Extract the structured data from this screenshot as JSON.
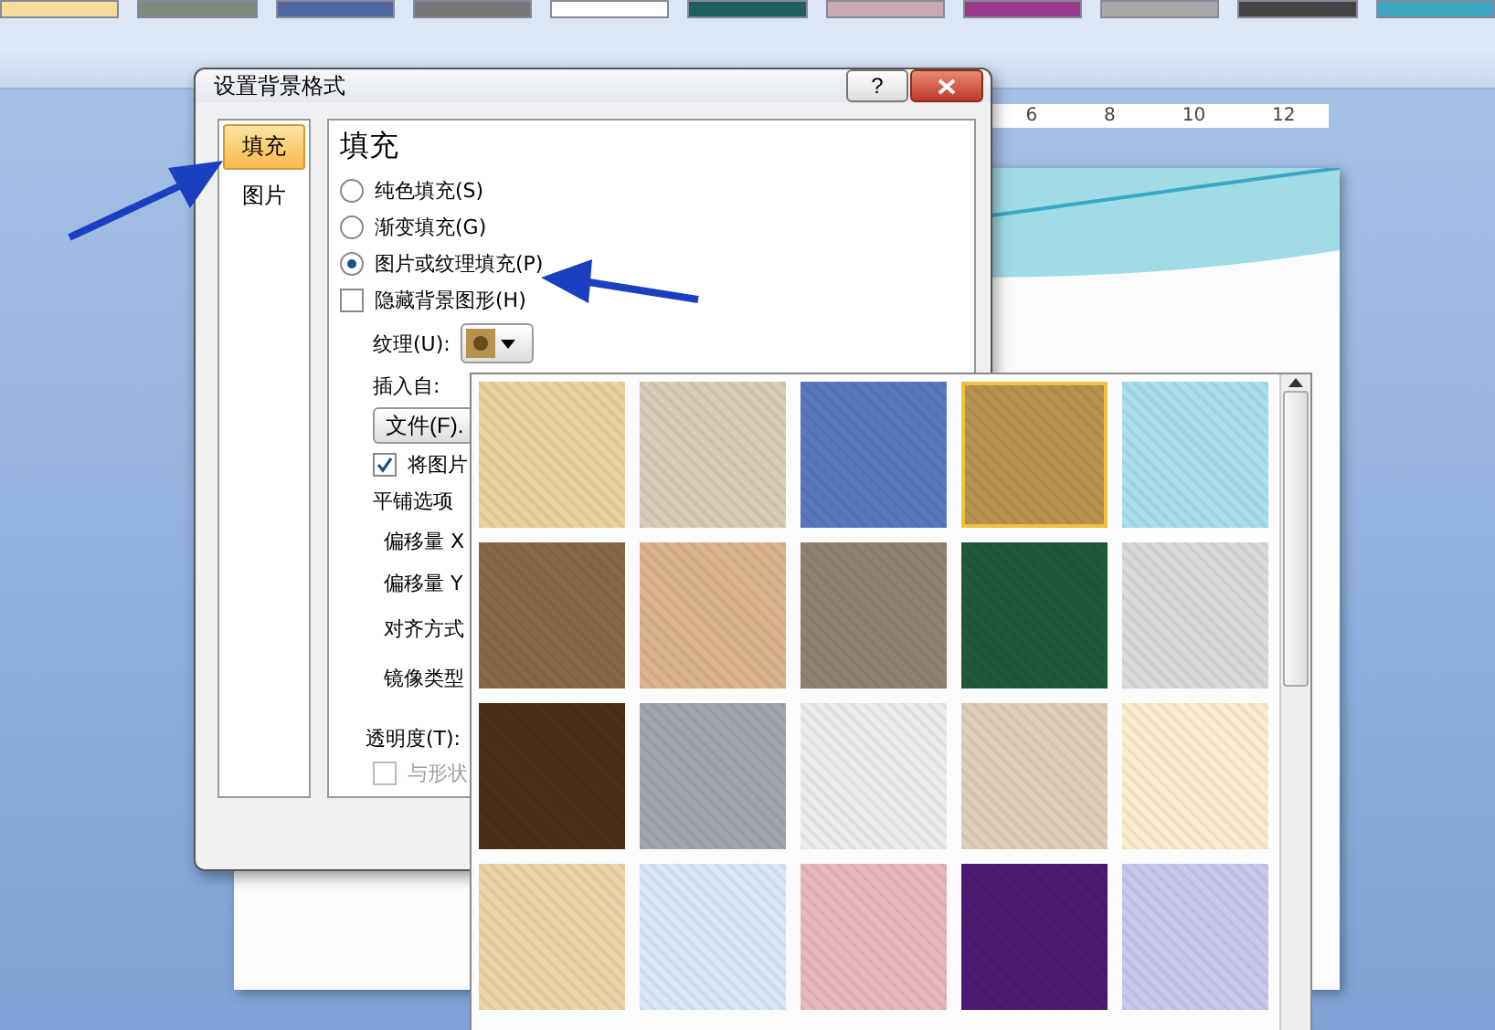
{
  "ruler": {
    "ticks": [
      "6",
      "8",
      "10",
      "12"
    ]
  },
  "dialog": {
    "title": "设置背景格式",
    "help": "?",
    "categories": [
      {
        "label": "填充",
        "selected": true
      },
      {
        "label": "图片",
        "selected": false
      }
    ],
    "heading": "填充",
    "fill_options": [
      {
        "label": "纯色填充(S)",
        "selected": false
      },
      {
        "label": "渐变填充(G)",
        "selected": false
      },
      {
        "label": "图片或纹理填充(P)",
        "selected": true
      }
    ],
    "hide_background": {
      "label": "隐藏背景图形(H)",
      "checked": false
    },
    "texture_label": "纹理(U):",
    "insert_from": "插入自:",
    "file_button": "文件(F).",
    "tile_checkbox": {
      "label": "将图片",
      "checked": true
    },
    "tiling_options": "平铺选项",
    "offset_x": "偏移量 X",
    "offset_y": "偏移量 Y",
    "alignment": "对齐方式",
    "mirror": "镜像类型",
    "transparency": "透明度(T):",
    "rotate_with_shape": {
      "label": "与形状",
      "checked": false,
      "disabled": true
    }
  },
  "texture_gallery": {
    "textures": [
      {
        "color": "#e9d39e",
        "selected": false
      },
      {
        "color": "#d8cdb6",
        "selected": false
      },
      {
        "color": "#5a78c0",
        "selected": false
      },
      {
        "color": "#b8924f",
        "selected": true
      },
      {
        "color": "#a9e0ec",
        "selected": false
      },
      {
        "color": "#8a6a45",
        "selected": false
      },
      {
        "color": "#d9b48d",
        "selected": false
      },
      {
        "color": "#8f8272",
        "selected": false
      },
      {
        "color": "#1f5a3a",
        "selected": false
      },
      {
        "color": "#dadada",
        "selected": false
      },
      {
        "color": "#4a2e16",
        "selected": false
      },
      {
        "color": "#a4a6ad",
        "selected": false
      },
      {
        "color": "#ececec",
        "selected": false
      },
      {
        "color": "#dfd0bc",
        "selected": false
      },
      {
        "color": "#fbecd0",
        "selected": false
      },
      {
        "color": "#ecd6a8",
        "selected": false
      },
      {
        "color": "#d9e8f8",
        "selected": false
      },
      {
        "color": "#e6b8bc",
        "selected": false
      },
      {
        "color": "#4b1a72",
        "selected": false
      },
      {
        "color": "#c8c8ee",
        "selected": false
      }
    ]
  }
}
